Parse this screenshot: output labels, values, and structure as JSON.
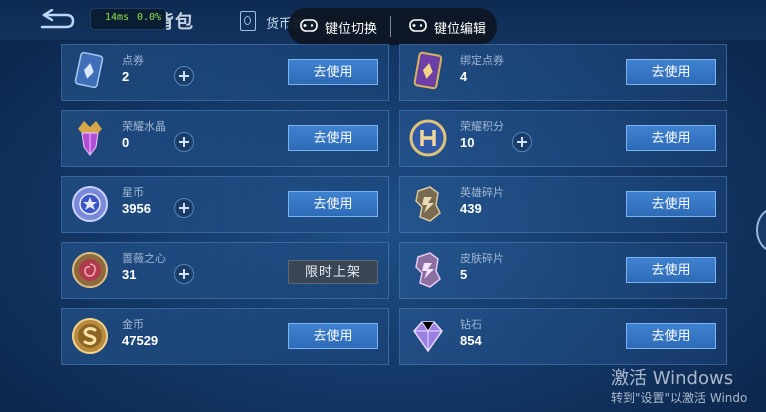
{
  "header": {
    "perf_ms": "14ms",
    "perf_pct": "0.0%",
    "title": "货币背包",
    "tab_flow": "货币流水",
    "flow_icon": "coin-flow-icon"
  },
  "keybar": {
    "switch_label": "键位切换",
    "edit_label": "键位编辑",
    "icon": "gamepad-icon"
  },
  "currencies": {
    "left": [
      {
        "name": "点券",
        "count": "2",
        "action": "去使用",
        "icon": "voucher-card-icon"
      },
      {
        "name": "荣耀水晶",
        "count": "0",
        "action": "去使用",
        "icon": "glory-crystal-icon"
      },
      {
        "name": "星币",
        "count": "3956",
        "action": "去使用",
        "icon": "star-coin-icon"
      },
      {
        "name": "蔷薇之心",
        "count": "31",
        "action": "限时上架",
        "icon": "rose-heart-icon"
      },
      {
        "name": "金币",
        "count": "47529",
        "action": "去使用",
        "icon": "gold-coin-icon"
      }
    ],
    "right": [
      {
        "name": "绑定点券",
        "count": "4",
        "action": "去使用",
        "icon": "bound-voucher-icon"
      },
      {
        "name": "荣耀积分",
        "count": "10",
        "action": "去使用",
        "icon": "glory-points-icon"
      },
      {
        "name": "英雄碎片",
        "count": "439",
        "action": "去使用",
        "icon": "hero-fragment-icon"
      },
      {
        "name": "皮肤碎片",
        "count": "5",
        "action": "去使用",
        "icon": "skin-fragment-icon"
      },
      {
        "name": "钻石",
        "count": "854",
        "action": "去使用",
        "icon": "diamond-icon"
      }
    ]
  },
  "watermark": {
    "line1": "激活 Windows",
    "line2": "转到\"设置\"以激活 Windo"
  },
  "colors": {
    "use_button": "#3a78c6",
    "limited_button": "#3a4654",
    "background": "#153c6c"
  }
}
